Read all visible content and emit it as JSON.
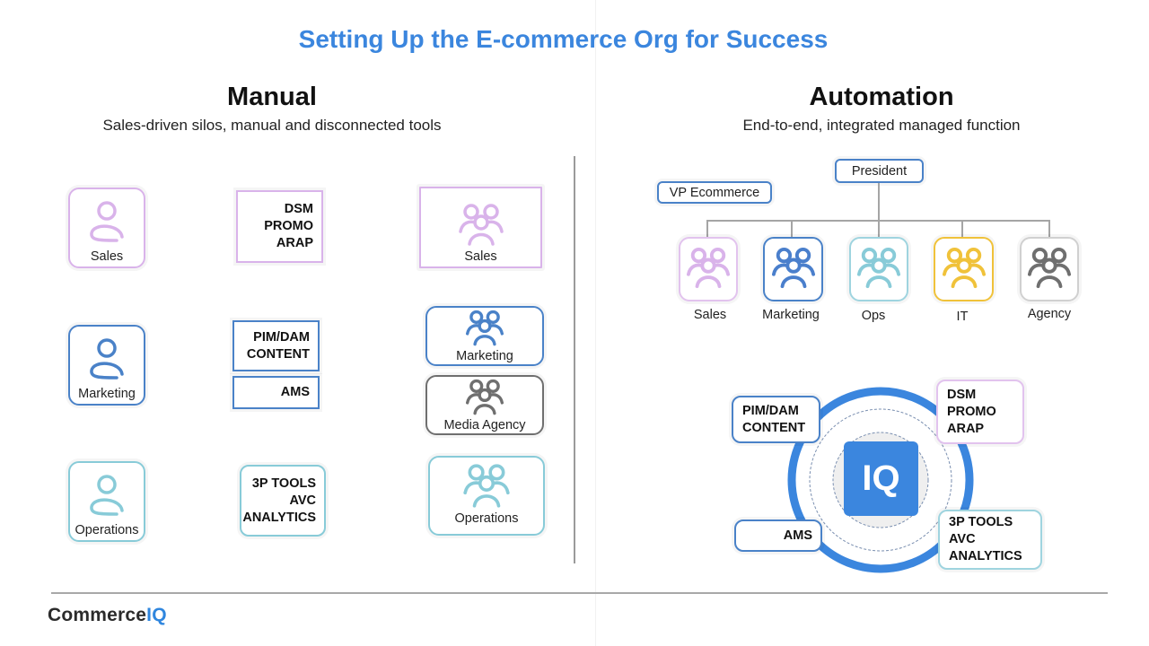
{
  "title": "Setting Up the E-commerce Org for Success",
  "manual": {
    "heading": "Manual",
    "subheading": "Sales-driven silos, manual and disconnected tools",
    "people": [
      {
        "label": "Sales",
        "color": "#d9b3ea"
      },
      {
        "label": "Marketing",
        "color": "#4a82c8"
      },
      {
        "label": "Operations",
        "color": "#88cbd8"
      }
    ],
    "tools": {
      "dsm": [
        "DSM",
        "PROMO",
        "ARAP"
      ],
      "pim": [
        "PIM/DAM",
        "CONTENT"
      ],
      "ams": [
        "AMS"
      ],
      "tools3p": [
        "3P TOOLS",
        "AVC",
        "ANALYTICS"
      ]
    },
    "teams": [
      {
        "label": "Sales",
        "color": "#d9b3ea"
      },
      {
        "label": "Marketing",
        "color": "#4a82c8"
      },
      {
        "label": "Media Agency",
        "color": "#6f6f6f"
      },
      {
        "label": "Operations",
        "color": "#88cbd8"
      }
    ]
  },
  "automation": {
    "heading": "Automation",
    "subheading": "End-to-end, integrated managed function",
    "president": "President",
    "vp": "VP Ecommerce",
    "teams": [
      {
        "label": "Sales",
        "color": "#d9b3ea"
      },
      {
        "label": "Marketing",
        "color": "#4a82c8"
      },
      {
        "label": "Ops",
        "color": "#88cbd8"
      },
      {
        "label": "IT",
        "color": "#f0c23a"
      },
      {
        "label": "Agency",
        "color": "#6f6f6f"
      }
    ],
    "hub_label": "IQ",
    "tools": {
      "pim": [
        "PIM/DAM",
        "CONTENT"
      ],
      "dsm": [
        "DSM",
        "PROMO",
        "ARAP"
      ],
      "ams": [
        "AMS"
      ],
      "tools3p": [
        "3P TOOLS",
        "AVC",
        "ANALYTICS"
      ]
    }
  },
  "footer": {
    "logo_main": "Commerce",
    "logo_accent": "IQ"
  }
}
